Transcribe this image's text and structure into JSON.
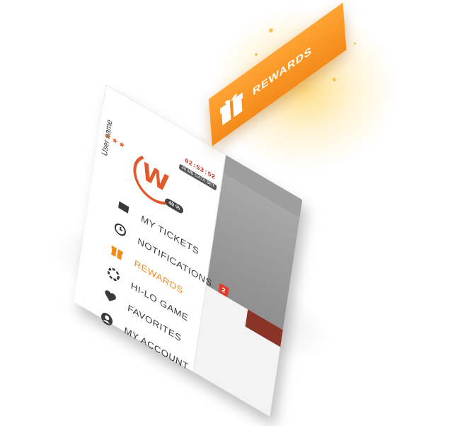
{
  "status": {
    "clock": "02:53:52",
    "clock_sub": "40 MB DATA SET"
  },
  "user": {
    "name": "User name",
    "rating": "★★★"
  },
  "progress": {
    "percent": 40,
    "label": "40 %"
  },
  "menu": {
    "items": [
      {
        "label": "MY TICKETS",
        "icon": "ticket-icon"
      },
      {
        "label": "NOTIFICATIONS",
        "icon": "clock-icon",
        "badge": "2"
      },
      {
        "label": "REWARDS",
        "icon": "gift-icon",
        "active": true
      },
      {
        "label": "HI-LO GAME",
        "icon": "chip-icon"
      },
      {
        "label": "FAVORITES",
        "icon": "heart-icon"
      },
      {
        "label": "MY ACCOUNT",
        "icon": "account-icon"
      }
    ]
  },
  "ribbon": {
    "label": "REWARDS",
    "icon": "gift-icon"
  },
  "colors": {
    "accent": "#f08c1e",
    "brand_red": "#e2592b",
    "topbar_brown": "#8a3428",
    "panel_grey": "#9e9e9e",
    "badge_red": "#e23b2b"
  }
}
